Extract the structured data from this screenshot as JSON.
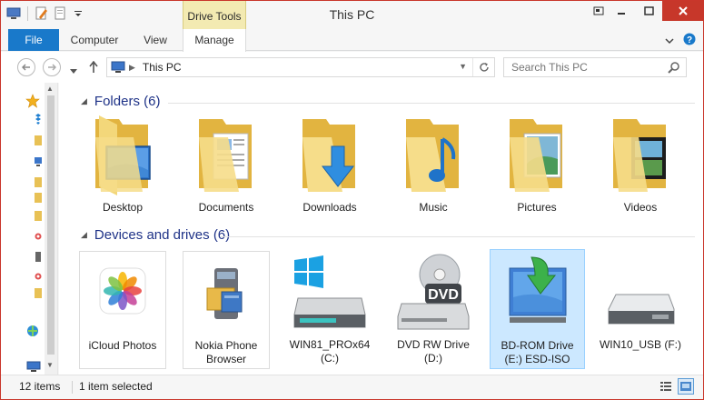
{
  "window": {
    "title": "This PC",
    "context_tab_group": "Drive Tools",
    "close_color": "#c7372a"
  },
  "ribbon": {
    "tabs": [
      "File",
      "Computer",
      "View",
      "Manage"
    ],
    "accent": "#1979ca"
  },
  "address": {
    "breadcrumb": "This PC"
  },
  "search": {
    "placeholder": "Search This PC"
  },
  "groups": {
    "folders": "Folders (6)",
    "devices": "Devices and drives (6)"
  },
  "folders": [
    {
      "label": "Desktop",
      "icon": "desktop-folder-icon"
    },
    {
      "label": "Documents",
      "icon": "documents-folder-icon"
    },
    {
      "label": "Downloads",
      "icon": "downloads-folder-icon"
    },
    {
      "label": "Music",
      "icon": "music-folder-icon"
    },
    {
      "label": "Pictures",
      "icon": "pictures-folder-icon"
    },
    {
      "label": "Videos",
      "icon": "videos-folder-icon"
    }
  ],
  "devices": [
    {
      "label_line1": "iCloud Photos",
      "label_line2": "",
      "icon": "icloud-photos-icon"
    },
    {
      "label_line1": "Nokia Phone",
      "label_line2": "Browser",
      "icon": "nokia-phone-browser-icon"
    },
    {
      "label_line1": "WIN81_PROx64",
      "label_line2": "(C:)",
      "icon": "windows-drive-icon"
    },
    {
      "label_line1": "DVD RW Drive",
      "label_line2": "(D:)",
      "icon": "dvd-drive-icon",
      "badge": "DVD"
    },
    {
      "label_line1": "BD-ROM Drive",
      "label_line2": "(E:) ESD-ISO",
      "icon": "bd-rom-drive-icon"
    },
    {
      "label_line1": "WIN10_USB (F:)",
      "label_line2": "",
      "icon": "usb-drive-icon"
    }
  ],
  "status": {
    "items": "12 items",
    "selected": "1 item selected"
  }
}
